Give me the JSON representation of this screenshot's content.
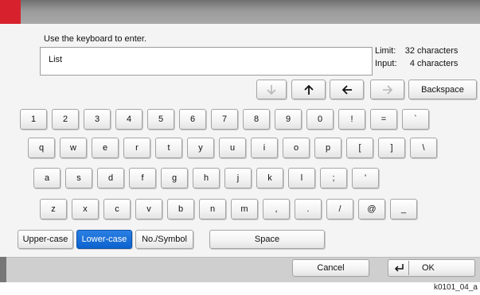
{
  "dialog": {
    "instruction": "Use the keyboard to enter.",
    "input_value": "List",
    "limit": {
      "label": "Limit:",
      "value": "32",
      "unit": "characters"
    },
    "input_count": {
      "label": "Input:",
      "value": "4",
      "unit": "characters"
    }
  },
  "nav_keys": {
    "down_icon": "arrow-down-icon",
    "up_icon": "arrow-up-icon",
    "left_icon": "arrow-left-icon",
    "right_icon": "arrow-right-icon",
    "backspace": "Backspace"
  },
  "keyboard": {
    "row1": [
      "1",
      "2",
      "3",
      "4",
      "5",
      "6",
      "7",
      "8",
      "9",
      "0",
      "!",
      "=",
      "`"
    ],
    "row2": [
      "q",
      "w",
      "e",
      "r",
      "t",
      "y",
      "u",
      "i",
      "o",
      "p",
      "[",
      "]",
      "\\"
    ],
    "row3": [
      "a",
      "s",
      "d",
      "f",
      "g",
      "h",
      "j",
      "k",
      "l",
      ";",
      "'"
    ],
    "row4": [
      "z",
      "x",
      "c",
      "v",
      "b",
      "n",
      "m",
      ",",
      ".",
      "/",
      "@",
      "_"
    ]
  },
  "mode_keys": {
    "upper_case": "Upper-case",
    "lower_case": "Lower-case",
    "no_symbol": "No./Symbol",
    "space": "Space",
    "active_mode": "Lower-case",
    "active_color": "#1a6fd8"
  },
  "footer": {
    "cancel": "Cancel",
    "ok": "OK",
    "enter_icon": "enter-icon"
  },
  "caption": "k0101_04_a"
}
